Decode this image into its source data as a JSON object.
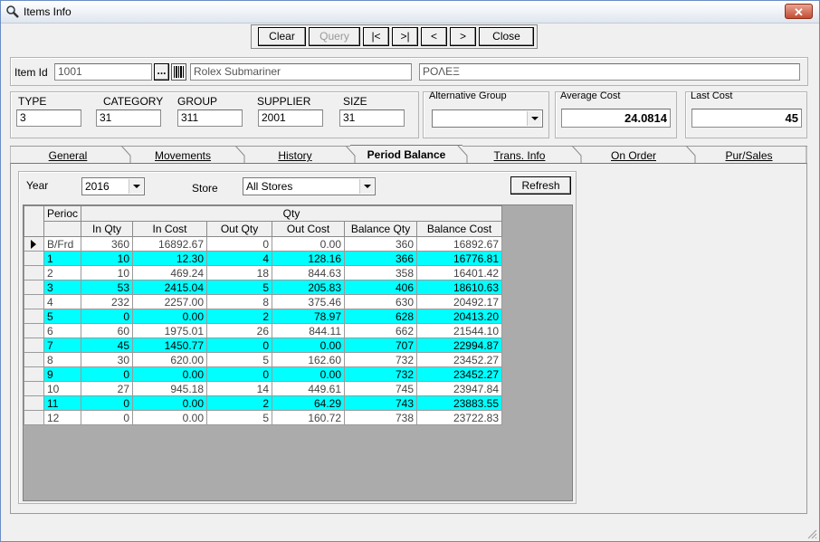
{
  "window": {
    "title": "Items Info",
    "close_glyph": "✕"
  },
  "toolbar": {
    "clear": "Clear",
    "query": "Query",
    "first": "|<",
    "last": ">|",
    "prev": "<",
    "next": ">",
    "close": "Close"
  },
  "item": {
    "id_label": "Item Id",
    "id_value": "1001",
    "lookup_btn": "...",
    "name": "Rolex Submariner",
    "name_alt": "ΡΟΛΕΞ"
  },
  "attrs": {
    "type_label": "TYPE",
    "type_value": "3",
    "category_label": "CATEGORY",
    "category_value": "31",
    "group_label": "GROUP",
    "group_value": "311",
    "supplier_label": "SUPPLIER",
    "supplier_value": "2001",
    "size_label": "SIZE",
    "size_value": "31"
  },
  "alt_group": {
    "label": "Alternative Group",
    "value": ""
  },
  "costs": {
    "avg_label": "Average Cost",
    "avg_value": "24.0814",
    "last_label": "Last Cost",
    "last_value": "45"
  },
  "tabs": [
    {
      "label": "General"
    },
    {
      "label": "Movements"
    },
    {
      "label": "History"
    },
    {
      "label": "Period Balance",
      "active": true
    },
    {
      "label": "Trans. Info"
    },
    {
      "label": "On Order"
    },
    {
      "label": "Pur/Sales"
    }
  ],
  "filters": {
    "year_label": "Year",
    "year_value": "2016",
    "store_label": "Store",
    "store_value": "All Stores",
    "refresh": "Refresh"
  },
  "grid": {
    "group_header_left": "Perioc",
    "group_header": "Qty",
    "columns": [
      "In Qty",
      "In Cost",
      "Out Qty",
      "Out Cost",
      "Balance Qty",
      "Balance Cost"
    ],
    "highlight_color": "#00ffff",
    "rows": [
      {
        "period": "B/Frd",
        "in_qty": "360",
        "in_cost": "16892.67",
        "out_qty": "0",
        "out_cost": "0.00",
        "bal_qty": "360",
        "bal_cost": "16892.67",
        "hl": false,
        "current": true
      },
      {
        "period": "1",
        "in_qty": "10",
        "in_cost": "12.30",
        "out_qty": "4",
        "out_cost": "128.16",
        "bal_qty": "366",
        "bal_cost": "16776.81",
        "hl": true
      },
      {
        "period": "2",
        "in_qty": "10",
        "in_cost": "469.24",
        "out_qty": "18",
        "out_cost": "844.63",
        "bal_qty": "358",
        "bal_cost": "16401.42",
        "hl": false
      },
      {
        "period": "3",
        "in_qty": "53",
        "in_cost": "2415.04",
        "out_qty": "5",
        "out_cost": "205.83",
        "bal_qty": "406",
        "bal_cost": "18610.63",
        "hl": true
      },
      {
        "period": "4",
        "in_qty": "232",
        "in_cost": "2257.00",
        "out_qty": "8",
        "out_cost": "375.46",
        "bal_qty": "630",
        "bal_cost": "20492.17",
        "hl": false
      },
      {
        "period": "5",
        "in_qty": "0",
        "in_cost": "0.00",
        "out_qty": "2",
        "out_cost": "78.97",
        "bal_qty": "628",
        "bal_cost": "20413.20",
        "hl": true
      },
      {
        "period": "6",
        "in_qty": "60",
        "in_cost": "1975.01",
        "out_qty": "26",
        "out_cost": "844.11",
        "bal_qty": "662",
        "bal_cost": "21544.10",
        "hl": false
      },
      {
        "period": "7",
        "in_qty": "45",
        "in_cost": "1450.77",
        "out_qty": "0",
        "out_cost": "0.00",
        "bal_qty": "707",
        "bal_cost": "22994.87",
        "hl": true
      },
      {
        "period": "8",
        "in_qty": "30",
        "in_cost": "620.00",
        "out_qty": "5",
        "out_cost": "162.60",
        "bal_qty": "732",
        "bal_cost": "23452.27",
        "hl": false
      },
      {
        "period": "9",
        "in_qty": "0",
        "in_cost": "0.00",
        "out_qty": "0",
        "out_cost": "0.00",
        "bal_qty": "732",
        "bal_cost": "23452.27",
        "hl": true
      },
      {
        "period": "10",
        "in_qty": "27",
        "in_cost": "945.18",
        "out_qty": "14",
        "out_cost": "449.61",
        "bal_qty": "745",
        "bal_cost": "23947.84",
        "hl": false
      },
      {
        "period": "11",
        "in_qty": "0",
        "in_cost": "0.00",
        "out_qty": "2",
        "out_cost": "64.29",
        "bal_qty": "743",
        "bal_cost": "23883.55",
        "hl": true
      },
      {
        "period": "12",
        "in_qty": "0",
        "in_cost": "0.00",
        "out_qty": "5",
        "out_cost": "160.72",
        "bal_qty": "738",
        "bal_cost": "23722.83",
        "hl": false
      }
    ]
  }
}
